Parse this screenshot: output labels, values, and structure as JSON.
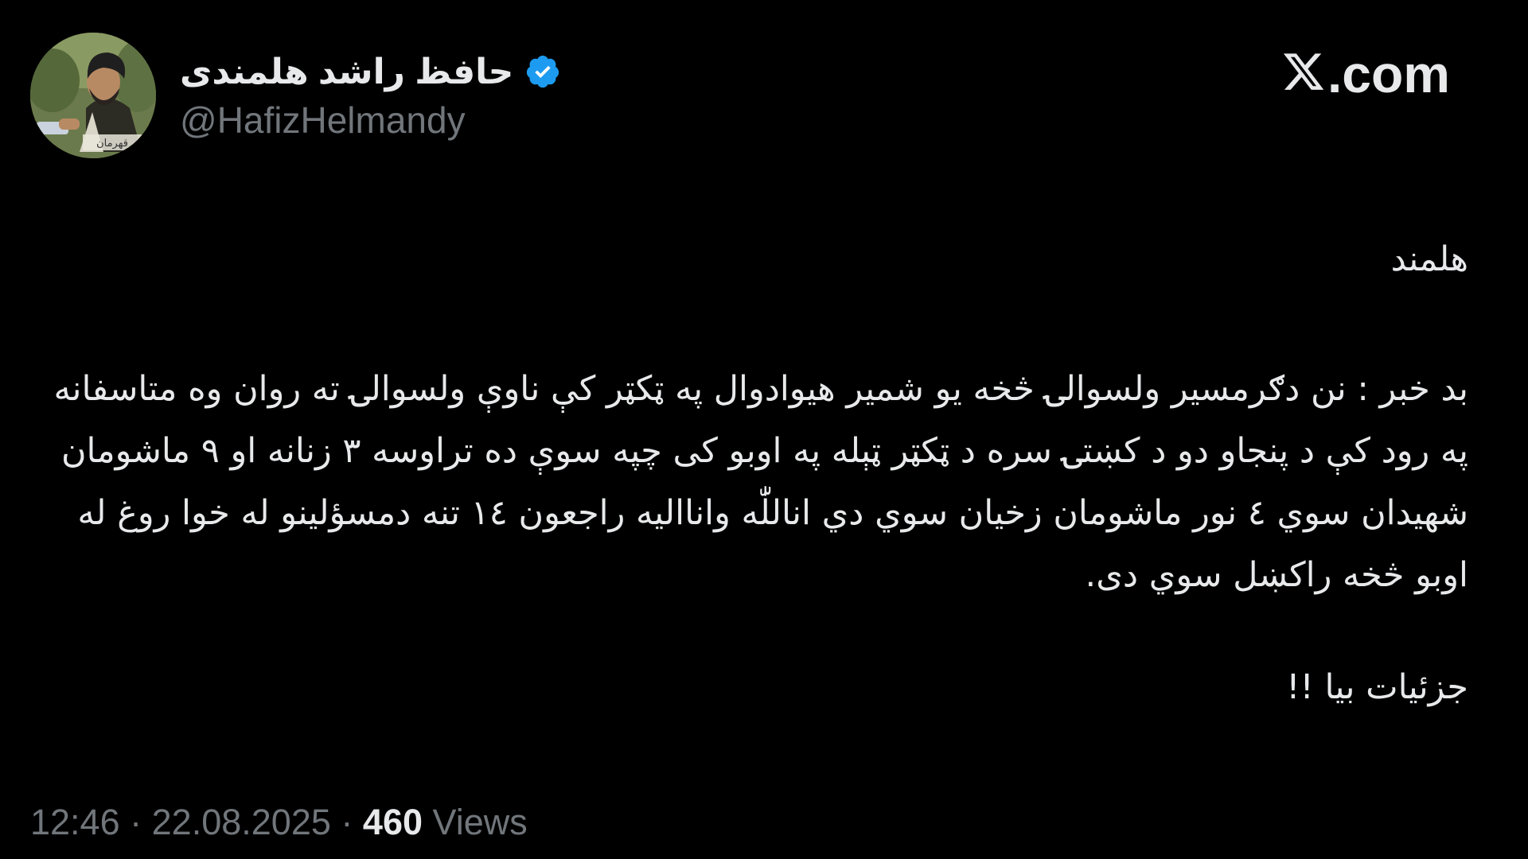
{
  "tweet": {
    "author": {
      "display_name": "حافظ راشد هلمندی",
      "handle": "@HafizHelmandy",
      "verified": true,
      "verified_badge_color": "#1d9bf0",
      "avatar_caption": "قهرمان"
    },
    "brand": {
      "text": ".com",
      "logo_icon": "x-logo-icon"
    },
    "paragraphs": [
      "هلمند",
      "بد خبر : نن دګرمسیر ولسوالۍ څخه یو شمیر هیوادوال په ټکټر کې ناوې ولسوالۍ ته روان وه متاسفانه په رود کې د پنجاو دو د کښتۍ سره د ټکټر ټېله په اوبو کی چپه سوې ده تراوسه ۳ زنانه او ۹ ماشومان شهیدان سوي ٤ نور ماشومان زخیان سوي دي اناللّٰه وانااليه راجعون ١٤ تنه دمسؤلینو له خوا روغ له اوبو څخه راکښل سوي دی.",
      "جزئیات بیا !!"
    ],
    "meta": {
      "time": "12:46",
      "date": "22.08.2025",
      "separator": "·",
      "views_count": "460",
      "views_label": "Views"
    }
  },
  "colors": {
    "background": "#000000",
    "text_primary": "#e7e9ea",
    "text_secondary": "#71767b",
    "accent": "#1d9bf0"
  }
}
